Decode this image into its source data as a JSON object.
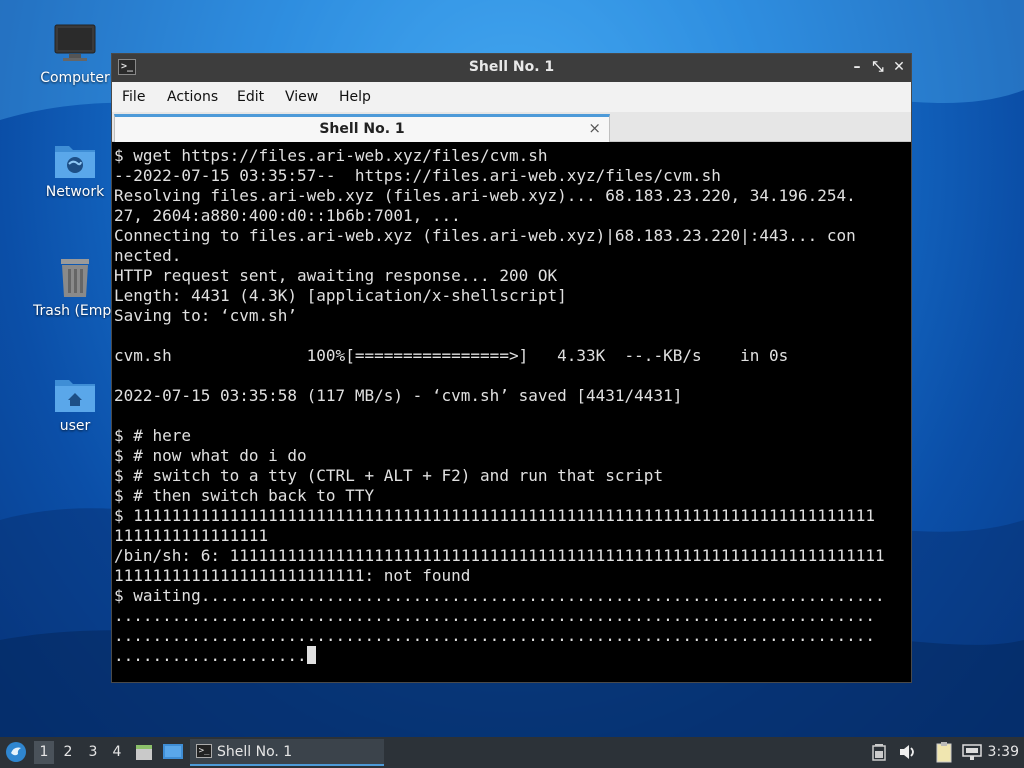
{
  "desktop": {
    "icons": [
      {
        "label": "Computer",
        "icon": "monitor-icon"
      },
      {
        "label": "Network",
        "icon": "network-folder-icon"
      },
      {
        "label": "Trash (Empty)",
        "icon": "trash-icon"
      },
      {
        "label": "user",
        "icon": "home-folder-icon"
      }
    ]
  },
  "window": {
    "title": "Shell No. 1",
    "controls": {
      "minimize": "–",
      "maximize": "⤡",
      "close": "✕"
    },
    "menu": [
      "File",
      "Actions",
      "Edit",
      "View",
      "Help"
    ],
    "tab": {
      "label": "Shell No. 1",
      "close": "×"
    }
  },
  "terminal": {
    "lines": [
      "$ wget https://files.ari-web.xyz/files/cvm.sh",
      "--2022-07-15 03:35:57--  https://files.ari-web.xyz/files/cvm.sh",
      "Resolving files.ari-web.xyz (files.ari-web.xyz)... 68.183.23.220, 34.196.254.",
      "27, 2604:a880:400:d0::1b6b:7001, ...",
      "Connecting to files.ari-web.xyz (files.ari-web.xyz)|68.183.23.220|:443... con",
      "nected.",
      "HTTP request sent, awaiting response... 200 OK",
      "Length: 4431 (4.3K) [application/x-shellscript]",
      "Saving to: ‘cvm.sh’",
      "",
      "cvm.sh              100%[================>]   4.33K  --.-KB/s    in 0s",
      "",
      "2022-07-15 03:35:58 (117 MB/s) - ‘cvm.sh’ saved [4431/4431]",
      "",
      "$ # here",
      "$ # now what do i do",
      "$ # switch to a tty (CTRL + ALT + F2) and run that script",
      "$ # then switch back to TTY",
      "$ 11111111111111111111111111111111111111111111111111111111111111111111111111111",
      "1111111111111111",
      "/bin/sh: 6: 11111111111111111111111111111111111111111111111111111111111111111111",
      "11111111111111111111111111: not found",
      "$ waiting.......................................................................",
      "...............................................................................",
      "...............................................................................",
      "...................."
    ]
  },
  "taskbar": {
    "workspaces": [
      "1",
      "2",
      "3",
      "4"
    ],
    "active_workspace": "1",
    "task": {
      "label": "Shell No. 1"
    },
    "clock": "3:39"
  },
  "colors": {
    "accent": "#4d9ad8",
    "terminal_bg": "#000000",
    "terminal_fg": "#e0e0e0",
    "taskbar_bg": "#2c3238"
  }
}
